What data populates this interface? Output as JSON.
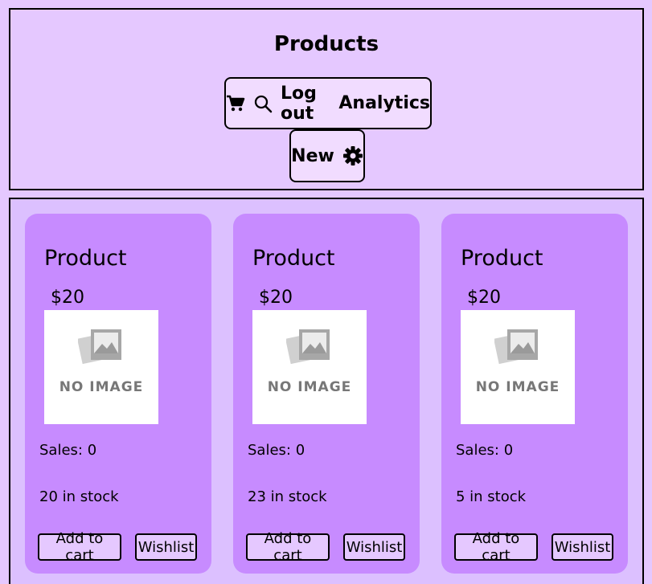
{
  "header": {
    "title": "Products",
    "nav": {
      "cart_icon": "cart-icon",
      "search_icon": "search-icon",
      "logout_label": "Log out",
      "analytics_label": "Analytics",
      "new_label": "New",
      "settings_icon": "gear-icon"
    }
  },
  "products": [
    {
      "name": "Product",
      "price": "$20",
      "image_text": "NO IMAGE",
      "sales": "Sales: 0",
      "stock": "20 in stock",
      "add_to_cart": "Add to cart",
      "wishlist": "Wishlist"
    },
    {
      "name": "Product",
      "price": "$20",
      "image_text": "NO IMAGE",
      "sales": "Sales: 0",
      "stock": "23 in stock",
      "add_to_cart": "Add to cart",
      "wishlist": "Wishlist"
    },
    {
      "name": "Product",
      "price": "$20",
      "image_text": "NO IMAGE",
      "sales": "Sales: 0",
      "stock": "5 in stock",
      "add_to_cart": "Add to cart",
      "wishlist": "Wishlist"
    }
  ],
  "colors": {
    "page_bg": "#e5c8ff",
    "card_bg": "#c78bff",
    "products_bg": "#dcc0ff"
  }
}
